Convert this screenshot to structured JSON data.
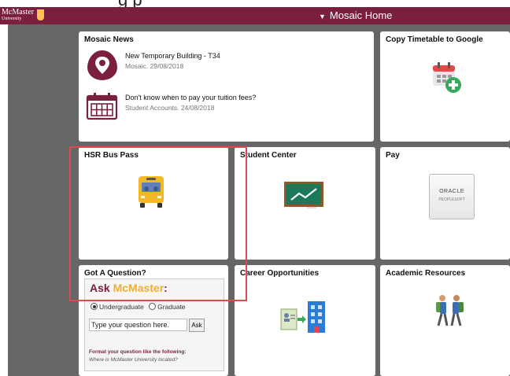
{
  "header": {
    "cropped_text": "g                  p",
    "logo_line1": "McMaster",
    "logo_line2": "University",
    "home_label": "Mosaic Home"
  },
  "tiles": {
    "news": {
      "title": "Mosaic News",
      "items": [
        {
          "title": "New Temporary Building - T34",
          "meta": "Mosaic. 29/08/2018",
          "icon": "location-pin-icon"
        },
        {
          "title": "Don't know when to pay your tuition fees?",
          "meta": "Student Accounts. 24/08/2018",
          "icon": "calendar-icon"
        }
      ]
    },
    "copy_timetable": {
      "title": "Copy Timetable to Google",
      "icon": "calendar-add-icon"
    },
    "hsr": {
      "title": "HSR Bus Pass",
      "icon": "bus-icon"
    },
    "student_center": {
      "title": "Student Center",
      "icon": "chalkboard-icon"
    },
    "pay": {
      "title": "Pay",
      "logo_line1": "ORACLE",
      "logo_line2": "PEOPLESOFT"
    },
    "got_question": {
      "title": "Got A Question?",
      "ask_prefix": "Ask ",
      "ask_brand": "McMaster",
      "ask_suffix": ":",
      "radio_undergrad": "Undergraduate",
      "radio_grad": "Graduate",
      "selected": "Undergraduate",
      "input_placeholder": "Type your question here.",
      "ask_button": "Ask",
      "format_title": "Format your question like the following:",
      "format_example": "Where is McMaster University located?"
    },
    "career": {
      "title": "Career Opportunities",
      "icon": "career-icon"
    },
    "academic": {
      "title": "Academic Resources",
      "icon": "students-walking-icon"
    }
  },
  "colors": {
    "brand": "#7a1f3d",
    "gold": "#f0b030",
    "highlight": "#e04a4a",
    "background": "#666666"
  }
}
